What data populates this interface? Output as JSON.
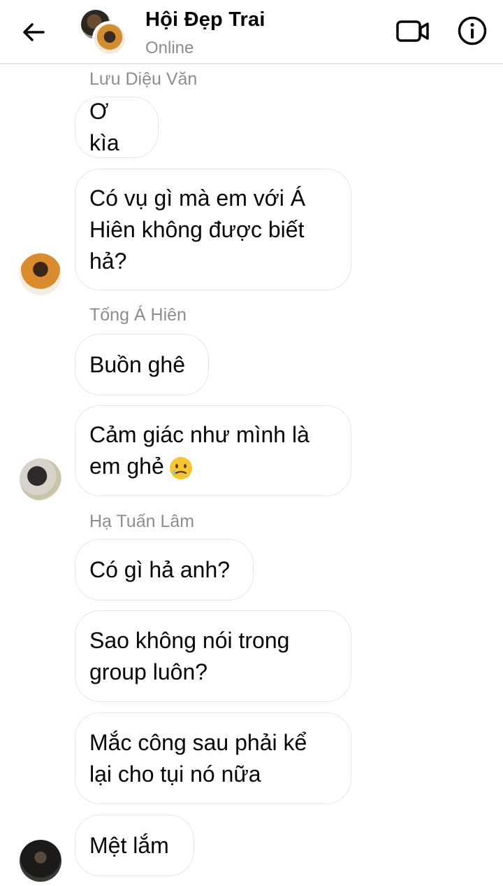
{
  "header": {
    "title": "Hội Đẹp Trai",
    "status": "Online",
    "icons": [
      "back-arrow-icon",
      "group-avatar",
      "video-call-icon",
      "info-icon"
    ]
  },
  "colors": {
    "bubble_border": "#e3e5e8",
    "secondary_text": "#8a8d91"
  },
  "messages": [
    {
      "sender": "Lưu Diệu Văn",
      "bubbles": [
        "Ơ kìa",
        [
          "Có vụ gì mà em với Á",
          "Hiên không được biết",
          "hả?"
        ]
      ]
    },
    {
      "sender": "Tống Á Hiên",
      "bubbles": [
        "Buồn ghê",
        [
          "Cảm giác như mình là",
          "em ghẻ"
        ]
      ],
      "emoji": "crying-face-emoji"
    },
    {
      "sender": "Hạ Tuấn Lâm",
      "bubbles": [
        "Có gì hả anh?",
        [
          "Sao không nói trong",
          "group luôn?"
        ],
        [
          "Mắc công sau phải kể",
          "lại cho tụi nó nữa"
        ],
        "Mệt lắm"
      ]
    }
  ]
}
